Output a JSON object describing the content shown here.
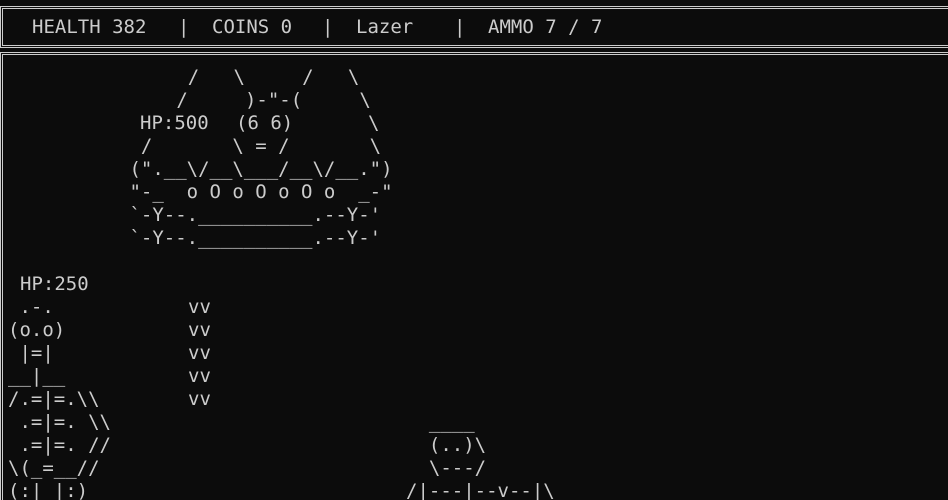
{
  "hud": {
    "health": "HEALTH 382",
    "coins": "COINS 0",
    "weapon": "Lazer",
    "ammo": "AMMO 7 / 7",
    "separator": "|"
  },
  "boss": {
    "hp_label": "HP:500",
    "art_top": "    /   \\     /   \\\n   /     )-\"-(     \\",
    "art_mid": "  /       \\ = /       \\\n (\".__\\/__\\___/__\\/__.\")\n \"-_  o O o O o O o  _-\"\n `-Y--.__________.--Y-'\n `-Y--.__________.--Y-'",
    "face": "(6 6)",
    "face_right": "\\"
  },
  "player": {
    "hp_label": "HP:250",
    "art": " .-.\n(o.o)\n |=|\n__|__\n/.=|=.\\\\\n .=|=. \\\\\n .=|=. //\n\\(_=__//\n(:| |:)"
  },
  "projectiles": {
    "art": "vv\nvv\nvv\nvv\nvv"
  },
  "minion": {
    "art": "  ____\n  (..)\\\n  \\---/\n/|---|--v--|\\"
  }
}
